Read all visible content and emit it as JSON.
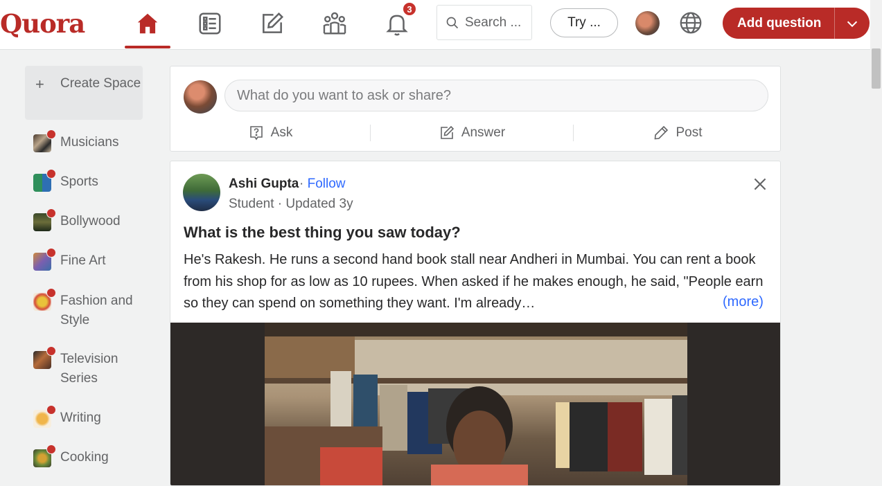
{
  "header": {
    "logo": "Quora",
    "notification_count": "3",
    "search_placeholder": "Search ...",
    "try_label": "Try ...",
    "add_question_label": "Add question",
    "colors": {
      "brand": "#b92b27",
      "link": "#2e69ff"
    }
  },
  "sidebar": {
    "create_space": "Create Space",
    "items": [
      {
        "label": "Musicians",
        "icon": "musicians-space-icon"
      },
      {
        "label": "Sports",
        "icon": "sports-space-icon"
      },
      {
        "label": "Bollywood",
        "icon": "bollywood-space-icon"
      },
      {
        "label": "Fine Art",
        "icon": "fine-art-space-icon"
      },
      {
        "label": "Fashion and Style",
        "icon": "fashion-space-icon"
      },
      {
        "label": "Television Series",
        "icon": "television-space-icon"
      },
      {
        "label": "Writing",
        "icon": "writing-space-icon"
      },
      {
        "label": "Cooking",
        "icon": "cooking-space-icon"
      }
    ]
  },
  "ask_box": {
    "placeholder": "What do you want to ask or share?",
    "ask": "Ask",
    "answer": "Answer",
    "post": "Post"
  },
  "post": {
    "author": "Ashi Gupta",
    "separator": "·",
    "follow": "Follow",
    "meta": "Student · Updated 3y",
    "title": "What is the best thing you saw today?",
    "body": "He's Rakesh. He runs a second hand book stall near Andheri in Mumbai. You can rent a book from his shop for as low as 10 rupees. When asked if he makes enough, he said, \"People earn so they can spend on something they want. I'm already…",
    "more": "(more)"
  }
}
